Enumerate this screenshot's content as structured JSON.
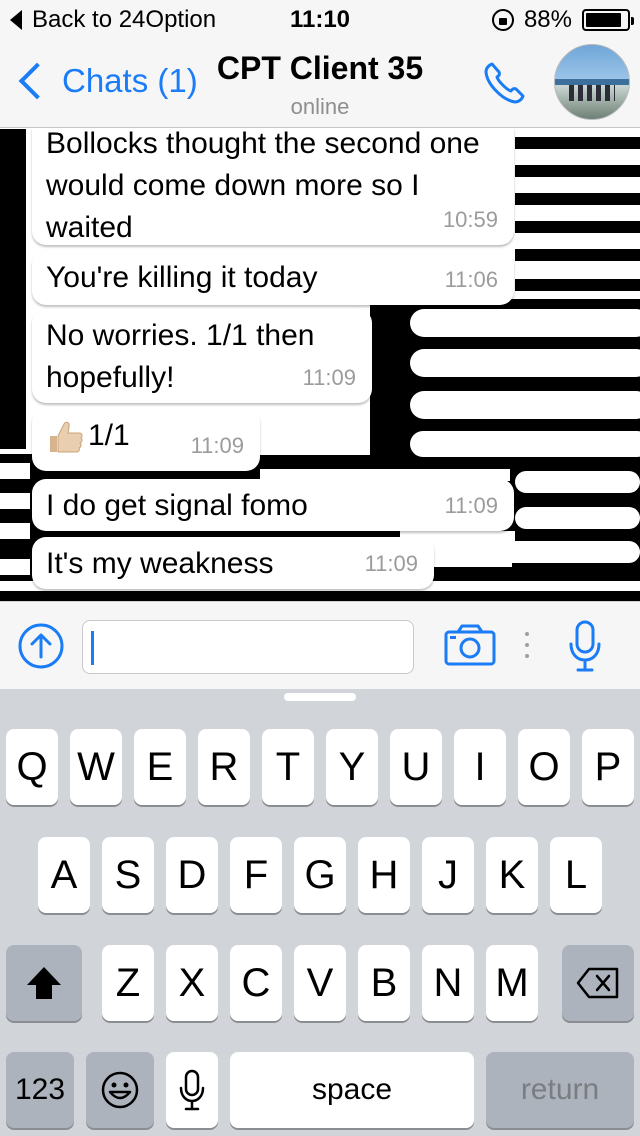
{
  "status_bar": {
    "back_label": "Back to 24Option",
    "time": "11:10",
    "battery_text": "88%",
    "battery_level": 0.88
  },
  "nav": {
    "back_label": "Chats (1)",
    "title": "CPT Client 35",
    "subtitle": "online"
  },
  "messages": [
    {
      "text": "Bollocks thought the second one would come down more so I waited",
      "time": "10:59"
    },
    {
      "text": "You're killing it today",
      "time": "11:06"
    },
    {
      "text": "No worries. 1/1 then hopefully!",
      "time": "11:09"
    },
    {
      "emoji": "thumbs-up",
      "text": "1/1",
      "time": "11:09"
    },
    {
      "text": "I do get signal fomo",
      "time": "11:09"
    },
    {
      "text": "It's my weakness",
      "time": "11:09"
    }
  ],
  "input": {
    "value": "",
    "placeholder": ""
  },
  "keyboard": {
    "row1": [
      "Q",
      "W",
      "E",
      "R",
      "T",
      "Y",
      "U",
      "I",
      "O",
      "P"
    ],
    "row2": [
      "A",
      "S",
      "D",
      "F",
      "G",
      "H",
      "J",
      "K",
      "L"
    ],
    "row3": [
      "Z",
      "X",
      "C",
      "V",
      "B",
      "N",
      "M"
    ],
    "numbers_label": "123",
    "space_label": "space",
    "return_label": "return"
  },
  "colors": {
    "accent": "#1a7cf6",
    "keyboard_bg": "#d1d4d9"
  }
}
